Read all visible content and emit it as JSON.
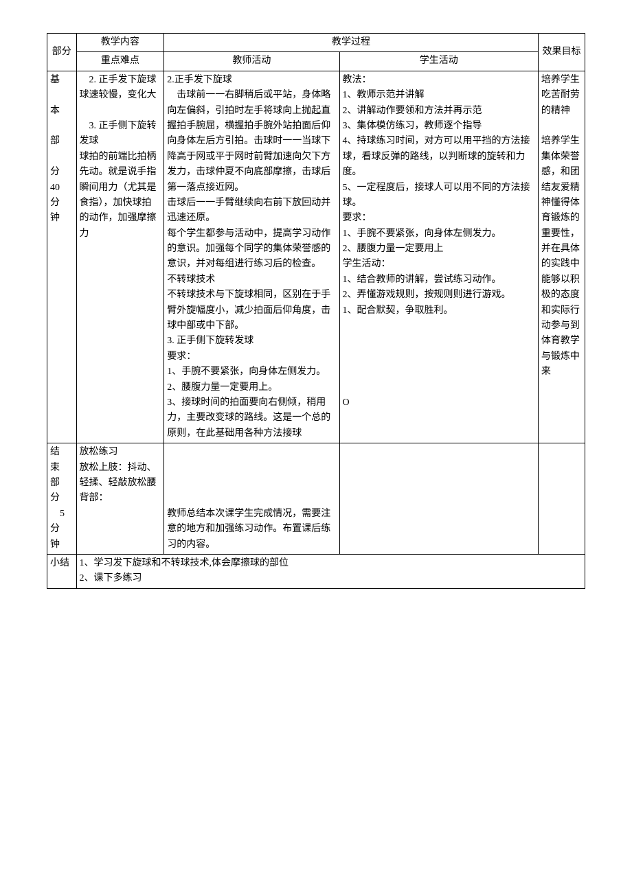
{
  "header": {
    "part_col": "部分",
    "content_col": "教学内容",
    "process_col": "教学过程",
    "effect_col": "效果目标",
    "sub_content": "重点难点",
    "sub_teacher": "教师活动",
    "sub_student": "学生活动"
  },
  "main": {
    "part_label": "基\n\n本\n\n部\n\n分\n40\n分\n钟",
    "content_text": "　2. 正手发下旋球\n球速较慢，变化大\n\n　3. 正手侧下旋转发球\n球拍的前端比拍柄先动。就是说手指瞬间用力（尤其是食指），加快球拍的动作，加强摩擦力",
    "teacher_text": "2.正手发下旋球\n　击球前一一右脚稍后或平站，身体略向左偏斜，引拍时左手将球向上抛起直握拍手腕屈，横握拍手腕外站拍面后仰向身体左后方引拍。击球时一一当球下降高于网或平于网时前臂加速向欠下方发力，击球仲夏不向底部摩擦，击球后第一落点接近网。\n击球后一一手臂继续向右前下放回动并迅速还原。\n每个学生都参与活动中，提高学习动作的意识。加强每个同学的集体荣誉感的意识，并对每组进行练习后的检查。\n不转球技术\n不转球技术与下旋球相同，区别在于手臂外旋幅度小，减少拍面后仰角度，击球中部或中下部。\n3. 正手侧下旋转发球\n要求：\n1、手腕不要紧张，向身体左侧发力。\n2、腰腹力量一定要用上。\n3、接球时间的拍面要向右侧倾，稍用力，主要改变球的路线。这是一个总的原则，在此基础用各种方法接球",
    "student_text": "教法：\n1、教师示范并讲解\n2、讲解动作要领和方法并再示范\n3、集体模仿练习，教师逐个指导\n4、持球练习时间，对方可以用平挡的方法接球，看球反弹的路线，以判断球的旋转和力度。\n5、一定程度后，接球人可以用不同的方法接球。\n要求：\n1、手腕不要紧张，向身体左侧发力。\n2、腰腹力量一定要用上\n学生活动：\n1、结合教师的讲解，尝试练习动作。\n2、弄懂游戏规则，按规则则进行游戏。\n1、配合默契，争取胜利。\n\n\n\n\n\nO",
    "effect_text": "培养学生吃苦耐劳的精神\n\n培养学生集体荣誉感，和团结友爱精神懂得体育锻炼的重要性，并在具体的实践中能够以积极的态度和实际行动参与到体育教学与锻炼中来"
  },
  "end": {
    "part_label": "结\n束\n部\n分\n　5\n分\n钟",
    "content_text": "放松练习\n放松上肢：抖动、轻揉、轻敲放松腰背部：",
    "teacher_text": "教师总结本次课学生完成情况，需要注意的地方和加强练习动作。布置课后练习的内容。",
    "student_text": "",
    "effect_text": ""
  },
  "summary": {
    "label": "小结",
    "text": "1、学习发下旋球和不转球技术,体会摩擦球的部位\n2、课下多练习"
  }
}
